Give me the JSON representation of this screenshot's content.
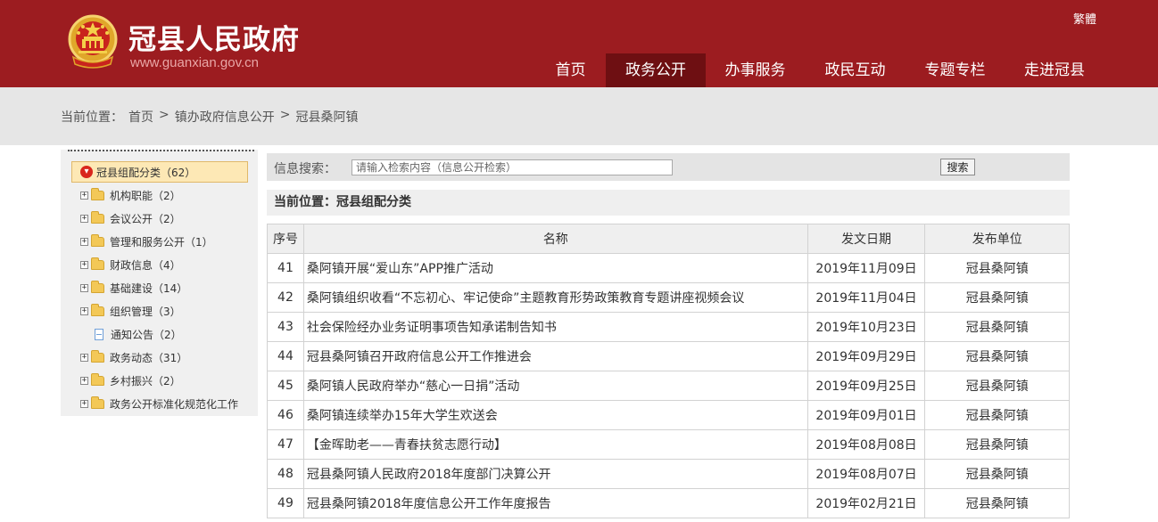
{
  "header": {
    "site_title": "冠县人民政府",
    "site_url": "www.guanxian.gov.cn",
    "traditional_link": "繁體",
    "nav": [
      {
        "label": "首页",
        "active": false
      },
      {
        "label": "政务公开",
        "active": true
      },
      {
        "label": "办事服务",
        "active": false
      },
      {
        "label": "政民互动",
        "active": false
      },
      {
        "label": "专题专栏",
        "active": false
      },
      {
        "label": "走进冠县",
        "active": false
      }
    ],
    "colors": {
      "brand": "#9c1c20",
      "nav_active": "#6e0f12"
    }
  },
  "breadcrumb": {
    "prefix": "当前位置：",
    "items": [
      "首页",
      "镇办政府信息公开",
      "冠县桑阿镇"
    ],
    "separator": ">"
  },
  "sidebar": {
    "root": {
      "label": "冠县组配分类（62）",
      "icon": "collapse-icon"
    },
    "items": [
      {
        "label": "机构职能（2）",
        "type": "folder"
      },
      {
        "label": "会议公开（2）",
        "type": "folder"
      },
      {
        "label": "管理和服务公开（1）",
        "type": "folder"
      },
      {
        "label": "财政信息（4）",
        "type": "folder"
      },
      {
        "label": "基础建设（14）",
        "type": "folder"
      },
      {
        "label": "组织管理（3）",
        "type": "folder"
      },
      {
        "label": "通知公告（2）",
        "type": "doc"
      },
      {
        "label": "政务动态（31）",
        "type": "folder"
      },
      {
        "label": "乡村振兴（2）",
        "type": "folder"
      },
      {
        "label": "政务公开标准化规范化工作",
        "type": "folder"
      }
    ]
  },
  "search": {
    "label": "信息搜索：",
    "placeholder": "请输入检索内容（信息公开检索）",
    "button": "搜索"
  },
  "sub_breadcrumb": "当前位置：冠县组配分类",
  "table": {
    "headers": [
      "序号",
      "名称",
      "发文日期",
      "发布单位"
    ],
    "rows": [
      {
        "num": "41",
        "title": "桑阿镇开展“爱山东”APP推广活动",
        "date": "2019年11月09日",
        "unit": "冠县桑阿镇"
      },
      {
        "num": "42",
        "title": "桑阿镇组织收看“不忘初心、牢记使命”主题教育形势政策教育专题讲座视频会议",
        "date": "2019年11月04日",
        "unit": "冠县桑阿镇"
      },
      {
        "num": "43",
        "title": "社会保险经办业务证明事项告知承诺制告知书",
        "date": "2019年10月23日",
        "unit": "冠县桑阿镇"
      },
      {
        "num": "44",
        "title": "冠县桑阿镇召开政府信息公开工作推进会",
        "date": "2019年09月29日",
        "unit": "冠县桑阿镇"
      },
      {
        "num": "45",
        "title": "桑阿镇人民政府举办“慈心一日捐”活动",
        "date": "2019年09月25日",
        "unit": "冠县桑阿镇"
      },
      {
        "num": "46",
        "title": "桑阿镇连续举办15年大学生欢送会",
        "date": "2019年09月01日",
        "unit": "冠县桑阿镇"
      },
      {
        "num": "47",
        "title": "【金晖助老——青春扶贫志愿行动】",
        "date": "2019年08月08日",
        "unit": "冠县桑阿镇"
      },
      {
        "num": "48",
        "title": "冠县桑阿镇人民政府2018年度部门决算公开",
        "date": "2019年08月07日",
        "unit": "冠县桑阿镇"
      },
      {
        "num": "49",
        "title": "冠县桑阿镇2018年度信息公开工作年度报告",
        "date": "2019年02月21日",
        "unit": "冠县桑阿镇"
      }
    ]
  }
}
